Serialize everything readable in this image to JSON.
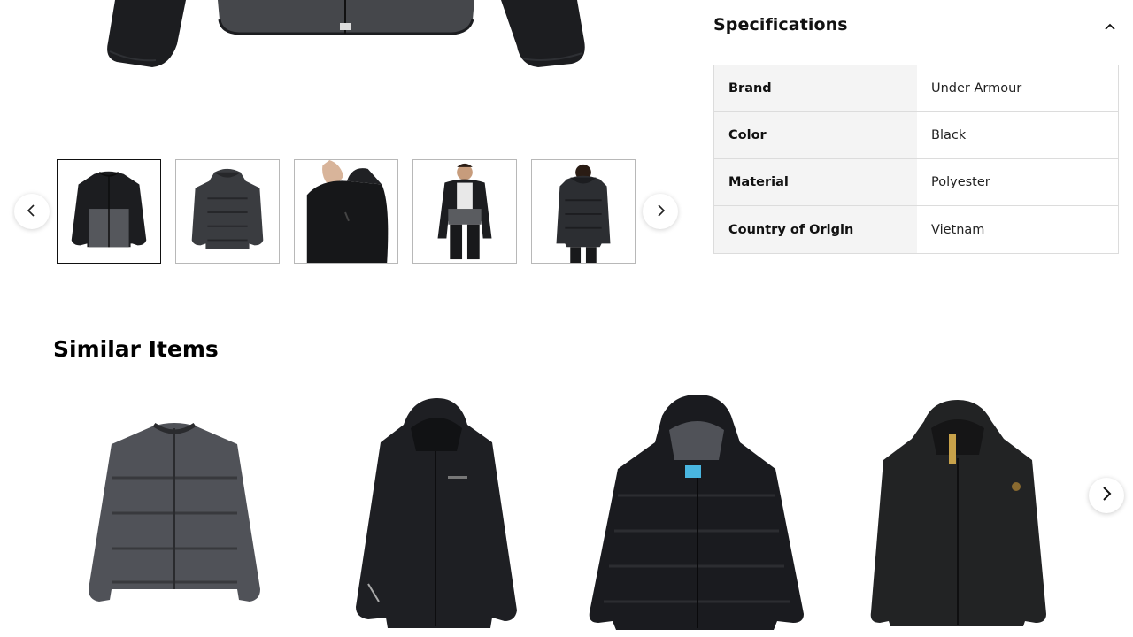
{
  "gallery": {
    "prev_icon": "chevron-left-icon",
    "next_icon": "chevron-right-icon",
    "thumbnails": [
      {
        "alt": "jacket-front",
        "active": true
      },
      {
        "alt": "jacket-back",
        "active": false
      },
      {
        "alt": "model-side-closeup",
        "active": false
      },
      {
        "alt": "model-front",
        "active": false
      },
      {
        "alt": "model-back",
        "active": false
      }
    ]
  },
  "specifications": {
    "title": "Specifications",
    "toggle_icon": "chevron-up-icon",
    "rows": [
      {
        "label": "Brand",
        "value": "Under Armour"
      },
      {
        "label": "Color",
        "value": "Black"
      },
      {
        "label": "Material",
        "value": "Polyester"
      },
      {
        "label": "Country of Origin",
        "value": "Vietnam"
      }
    ]
  },
  "similar_items": {
    "title": "Similar Items",
    "next_icon": "chevron-right-icon"
  },
  "colors": {
    "jacket_dark": "#1c1d20",
    "jacket_grey": "#4a4c50",
    "table_key_bg": "#f4f4f4",
    "border": "#dcdcdc"
  }
}
